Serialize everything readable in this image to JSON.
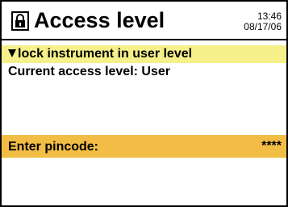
{
  "header": {
    "icon": "padlock-icon",
    "title": "Access level",
    "time": "13:46",
    "date": "08/17/06"
  },
  "menu": {
    "selected_item": "lock instrument in user level",
    "highlight_color": "#f5f08a"
  },
  "status": {
    "current_access_text": "Current access level: User"
  },
  "pincode": {
    "label": "Enter pincode:",
    "value": "****",
    "highlight_color": "#f2bd45"
  }
}
